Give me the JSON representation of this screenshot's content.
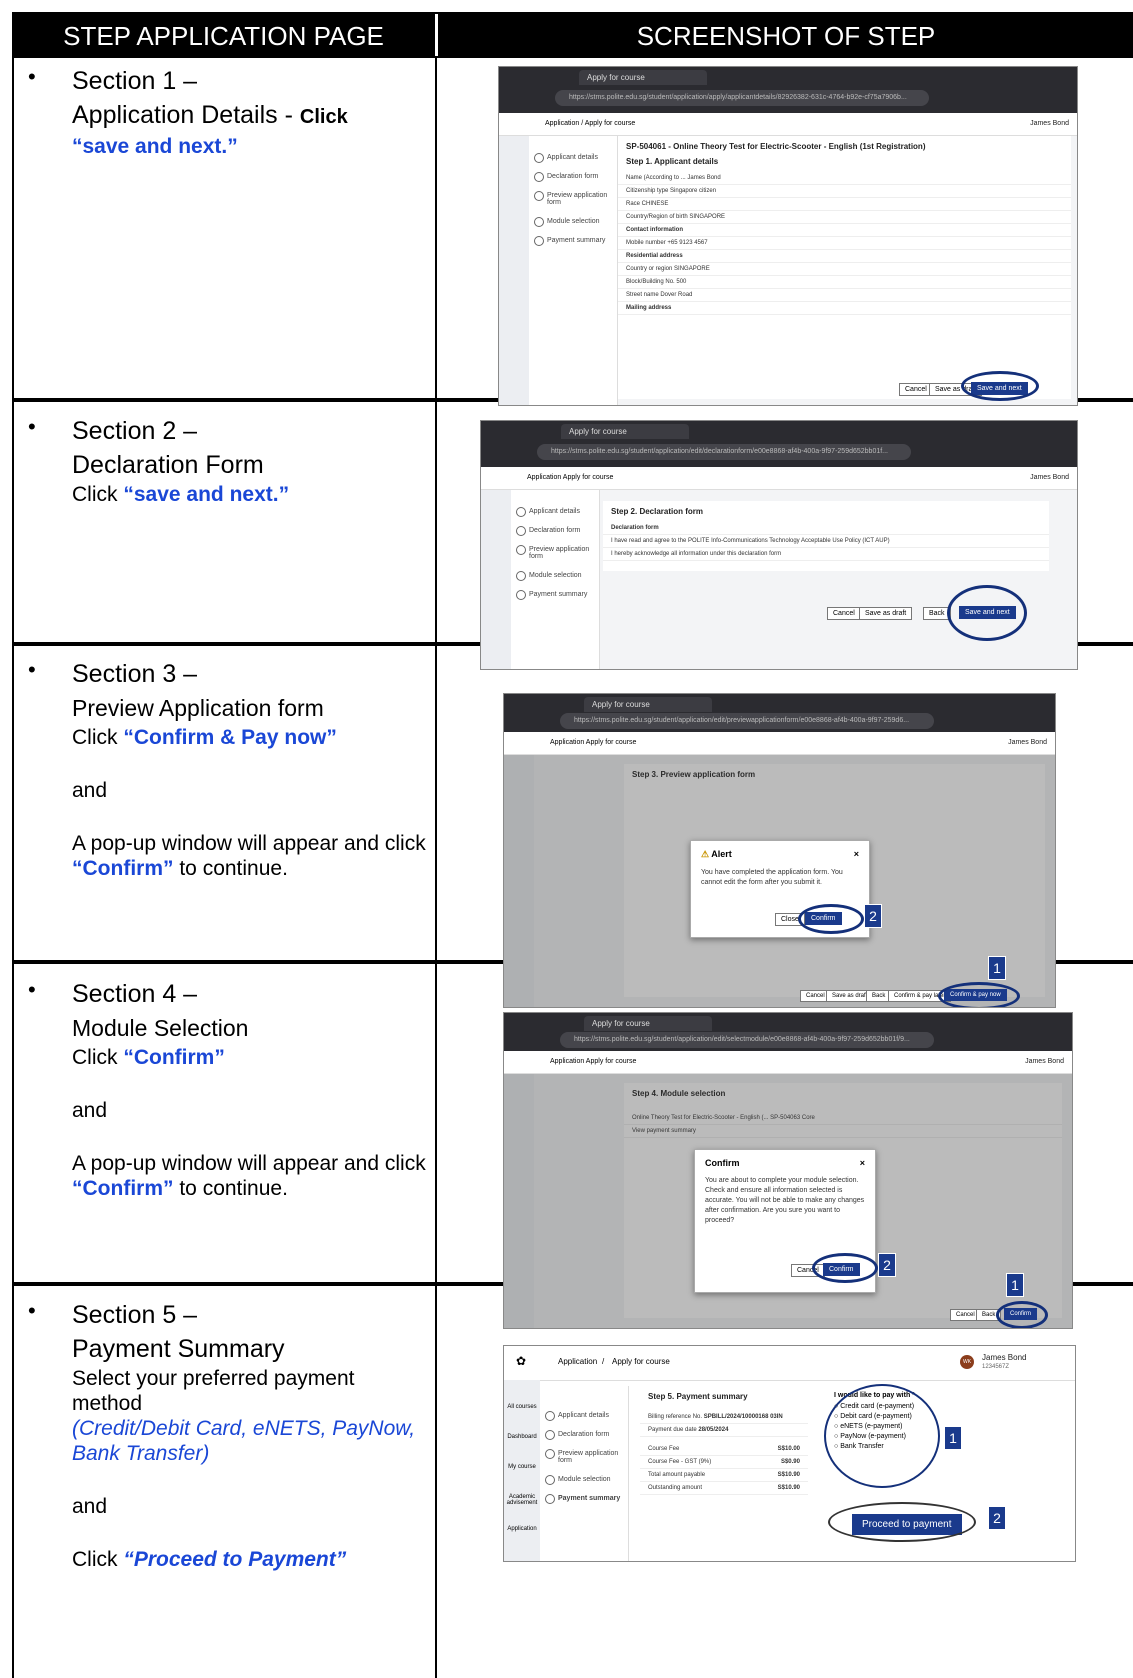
{
  "header": {
    "left": "STEP APPLICATION PAGE",
    "right": "SCREENSHOT OF STEP"
  },
  "sections": [
    {
      "title_1": "Section 1 –",
      "title_2": "Application Details -",
      "click_word": "Click",
      "click_target": "“save and next.”",
      "screenshot": {
        "tab": "Apply for course",
        "url": "https://stms.polite.edu.sg/student/application/apply/applicantdetails/82926382-631c-4764-b92e-cf75a7906b...",
        "breadcrumb": "Application / Apply for course",
        "user": "James Bond",
        "course_title": "SP-504061 - Online Theory Test for Electric-Scooter - English (1st Registration)",
        "step_heading": "Step 1. Applicant details",
        "steps": [
          "Applicant details",
          "Declaration form",
          "Preview application form",
          "Module selection",
          "Payment summary"
        ],
        "rows": [
          "Name (According to ...   James Bond",
          "Citizenship type   Singapore citizen",
          "Race   CHINESE",
          "Country/Region of birth   SINGAPORE",
          "Contact information",
          "Mobile number   +65 9123 4567",
          "Residential address",
          "Country or region   SINGAPORE",
          "Block/Building No.   500",
          "Street name   Dover Road",
          "Mailing address"
        ],
        "buttons": [
          "Cancel",
          "Save as draft",
          "Save and next"
        ]
      }
    },
    {
      "title_1": "Section 2 –",
      "title_2": "Declaration Form",
      "click_word": "Click",
      "click_target": "“save and next.”",
      "screenshot": {
        "tab": "Apply for course",
        "url": "https://stms.polite.edu.sg/student/application/edit/declarationform/e00e8868-af4b-400a-9f97-259d652bb01f...",
        "breadcrumb": "Application   Apply for course",
        "user": "James Bond",
        "step_heading": "Step 2. Declaration form",
        "rows": [
          "Declaration form",
          "I have read and agree to the POLITE Info-Communications Technology Acceptable Use Policy (ICT AUP)",
          "I hereby acknowledge all information under this declaration form"
        ],
        "steps": [
          "Applicant details",
          "Declaration form",
          "Preview application form",
          "Module selection",
          "Payment summary"
        ],
        "buttons": [
          "Cancel",
          "Save as draft",
          "Back",
          "Save and next"
        ]
      }
    },
    {
      "title_1": "Section 3 –",
      "title_2": "Preview Application form",
      "click_word": "Click",
      "click_target": "“Confirm & Pay now”",
      "and": "and",
      "popup_text": "A pop-up window will appear and click",
      "popup_target": "“Confirm”",
      "popup_end": "to continue.",
      "screenshot": {
        "tab": "Apply for course",
        "url": "https://stms.polite.edu.sg/student/application/edit/previewapplicationform/e00e8868-af4b-400a-9f97-259d6...",
        "breadcrumb": "Application   Apply for course",
        "user": "James Bond",
        "step_heading": "Step 3. Preview application form",
        "dialog_title": "Alert",
        "dialog_body": "You have completed the application form. You cannot edit the form after you submit it.",
        "dialog_close": "Close",
        "dialog_confirm": "Confirm",
        "bottom_buttons": [
          "Cancel",
          "Save as draft",
          "Back",
          "Confirm & pay later",
          "Confirm & pay now"
        ],
        "marker_1": "1",
        "marker_2": "2"
      }
    },
    {
      "title_1": "Section 4 –",
      "title_2": "Module Selection",
      "click_word": "Click",
      "click_target": "“Confirm”",
      "and": "and",
      "popup_text": "A pop-up window will appear and click",
      "popup_target": "“Confirm”",
      "popup_end": "to continue.",
      "screenshot": {
        "tab": "Apply for course",
        "url": "https://stms.polite.edu.sg/student/application/edit/selectmodule/e00e8868-af4b-400a-9f97-259d652bb01f/9...",
        "breadcrumb": "Application   Apply for course",
        "user": "James Bond",
        "step_heading": "Step 4. Module selection",
        "table_row": "Online Theory Test for Electric-Scooter - English (...   SP-504063   Core",
        "view_payment": "View payment summary",
        "dialog_title": "Confirm",
        "dialog_body": "You are about to complete your module selection. Check and ensure all information selected is accurate. You will not be able to make any changes after confirmation. Are you sure you want to proceed?",
        "dialog_cancel": "Cancel",
        "dialog_confirm": "Confirm",
        "bottom_buttons": [
          "Cancel",
          "Back",
          "Confirm"
        ],
        "marker_1": "1",
        "marker_2": "2"
      }
    },
    {
      "title_1": "Section 5 –",
      "title_2": "Payment Summary",
      "select_text": "Select your preferred payment method",
      "methods": "(Credit/Debit Card, eNETS, PayNow, Bank Transfer)",
      "and": "and",
      "click_word": "Click",
      "click_target": "“Proceed to Payment”",
      "screenshot": {
        "breadcrumb_1": "Application",
        "breadcrumb_2": "Apply for course",
        "user": "James Bond",
        "user_id": "1234567Z",
        "avatar": "WK",
        "sidebar": [
          "All courses",
          "Dashboard",
          "My course",
          "Academic advisement",
          "Application"
        ],
        "steps": [
          "Applicant details",
          "Declaration form",
          "Preview application form",
          "Module selection",
          "Payment summary"
        ],
        "step_heading": "Step 5. Payment summary",
        "billing_label": "Billing reference No.",
        "billing_value": "SPBILL/2024/10000168 03IN",
        "due_label": "Payment due date",
        "due_value": "28/05/2024",
        "fees": [
          {
            "label": "Course Fee",
            "value": "S$10.00"
          },
          {
            "label": "Course Fee - GST (9%)",
            "value": "S$0.90"
          },
          {
            "label": "Total amount payable",
            "value": "S$10.90"
          },
          {
            "label": "Outstanding amount",
            "value": "S$10.90"
          }
        ],
        "pay_with": "I would like to pay with *",
        "options": [
          "Credit card (e-payment)",
          "Debit card (e-payment)",
          "eNETS (e-payment)",
          "PayNow (e-payment)",
          "Bank Transfer"
        ],
        "proceed": "Proceed to payment",
        "marker_1": "1",
        "marker_2": "2"
      }
    }
  ]
}
